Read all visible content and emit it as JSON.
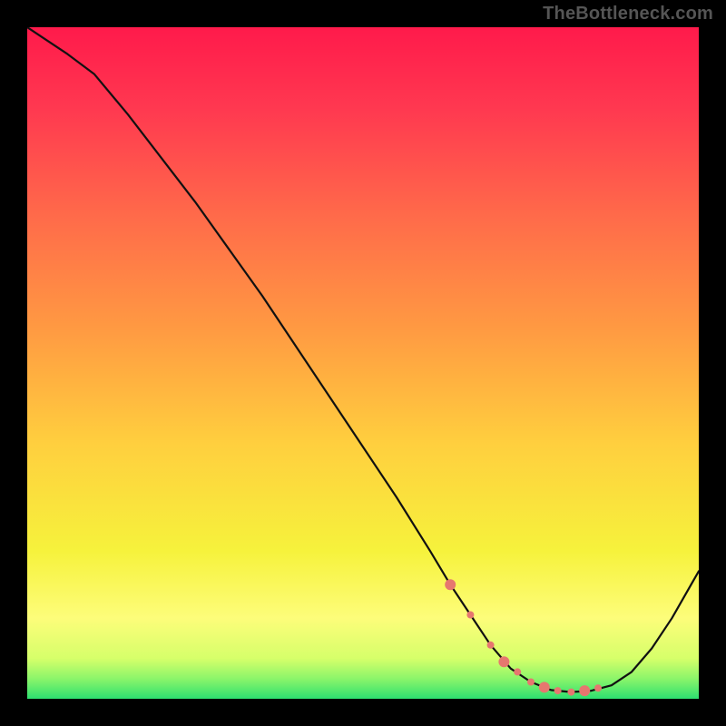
{
  "watermark": "TheBottleneck.com",
  "gradient": {
    "stops": [
      {
        "offset": "0%",
        "color": "#ff1a4b"
      },
      {
        "offset": "12%",
        "color": "#ff3850"
      },
      {
        "offset": "28%",
        "color": "#ff6a4a"
      },
      {
        "offset": "45%",
        "color": "#ff9a42"
      },
      {
        "offset": "62%",
        "color": "#ffcf3e"
      },
      {
        "offset": "78%",
        "color": "#f6f23c"
      },
      {
        "offset": "88%",
        "color": "#fdfd7a"
      },
      {
        "offset": "94%",
        "color": "#d6ff6a"
      },
      {
        "offset": "97%",
        "color": "#8cf56a"
      },
      {
        "offset": "100%",
        "color": "#2de070"
      }
    ]
  },
  "curve_style": {
    "stroke": "#111",
    "stroke_width": 2.2
  },
  "dot_style": {
    "fill": "#e6776f"
  },
  "chart_data": {
    "type": "line",
    "title": "",
    "xlabel": "",
    "ylabel": "",
    "xlim": [
      0,
      100
    ],
    "ylim": [
      0,
      100
    ],
    "series": [
      {
        "name": "bottleneck-curve",
        "x": [
          0,
          3,
          6,
          10,
          15,
          20,
          25,
          30,
          35,
          40,
          45,
          50,
          55,
          60,
          63,
          66,
          69,
          72,
          75,
          78,
          81,
          84,
          87,
          90,
          93,
          96,
          100
        ],
        "y": [
          100,
          98,
          96,
          93,
          87,
          80.5,
          74,
          67,
          60,
          52.5,
          45,
          37.5,
          30,
          22,
          17,
          12.5,
          8,
          4.5,
          2.5,
          1.3,
          1,
          1.2,
          2,
          4,
          7.5,
          12,
          19
        ]
      }
    ],
    "highlight_points": {
      "name": "sweet-spot",
      "x": [
        63,
        66,
        69,
        71,
        73,
        75,
        77,
        79,
        81,
        83,
        85
      ],
      "y": [
        17,
        12.5,
        8,
        5.5,
        4,
        2.5,
        1.7,
        1.2,
        1,
        1.2,
        1.6
      ]
    }
  }
}
